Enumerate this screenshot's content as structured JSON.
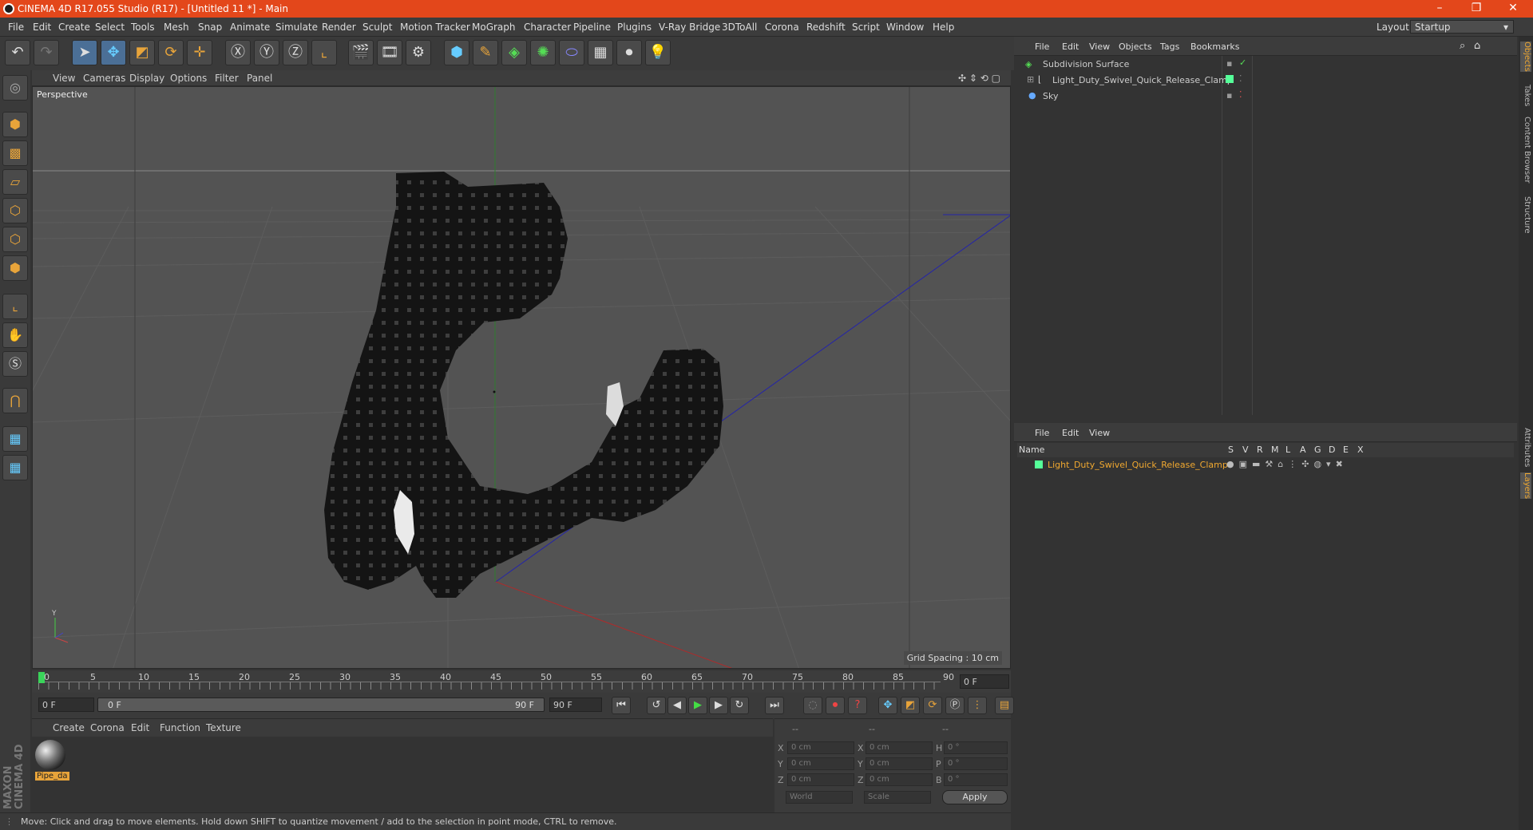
{
  "title": "CINEMA 4D R17.055 Studio (R17) - [Untitled 11 *] - Main",
  "menu": [
    "File",
    "Edit",
    "Create",
    "Select",
    "Tools",
    "Mesh",
    "Snap",
    "Animate",
    "Simulate",
    "Render",
    "Sculpt",
    "Motion Tracker",
    "MoGraph",
    "Character",
    "Pipeline",
    "Plugins",
    "V-Ray Bridge",
    "3DToAll",
    "Corona",
    "Redshift",
    "Script",
    "Window",
    "Help"
  ],
  "layout": {
    "label": "Layout:",
    "value": "Startup"
  },
  "viewport": {
    "menu": [
      "View",
      "Cameras",
      "Display",
      "Options",
      "Filter",
      "Panel"
    ],
    "label": "Perspective",
    "grid_spacing": "Grid Spacing : 10 cm"
  },
  "timeline": {
    "ticks": [
      "0",
      "5",
      "10",
      "15",
      "20",
      "25",
      "30",
      "35",
      "40",
      "45",
      "50",
      "55",
      "60",
      "65",
      "70",
      "75",
      "80",
      "85",
      "90"
    ],
    "end_frame": "0 F",
    "start_field": "0 F",
    "range_start": "0 F",
    "range_end": "90 F",
    "end_field": "90 F"
  },
  "material": {
    "menu": [
      "Create",
      "Corona",
      "Edit",
      "Function",
      "Texture"
    ],
    "item": "Pipe_da"
  },
  "coords": {
    "dash": "--",
    "rows": [
      [
        "X",
        "0 cm",
        "X",
        "0 cm",
        "H",
        "0 °"
      ],
      [
        "Y",
        "0 cm",
        "Y",
        "0 cm",
        "P",
        "0 °"
      ],
      [
        "Z",
        "0 cm",
        "Z",
        "0 cm",
        "B",
        "0 °"
      ]
    ],
    "world": "World",
    "scale": "Scale",
    "apply": "Apply"
  },
  "objects": {
    "menu": [
      "File",
      "Edit",
      "View",
      "Objects",
      "Tags",
      "Bookmarks"
    ],
    "items": [
      "Subdivision Surface",
      "Light_Duty_Swivel_Quick_Release_Clamp",
      "Sky"
    ]
  },
  "layers": {
    "menu": [
      "File",
      "Edit",
      "View"
    ],
    "headers": [
      "Name",
      "S",
      "V",
      "R",
      "M",
      "L",
      "A",
      "G",
      "D",
      "E",
      "X"
    ],
    "item": "Light_Duty_Swivel_Quick_Release_Clamp"
  },
  "status": "Move: Click and drag to move elements. Hold down SHIFT to quantize movement / add to the selection in point mode, CTRL to remove.",
  "side_tabs": [
    "Objects",
    "Takes",
    "Content Browser",
    "Structure",
    "Attributes",
    "Layers"
  ],
  "brand": "MAXON CINEMA 4D"
}
